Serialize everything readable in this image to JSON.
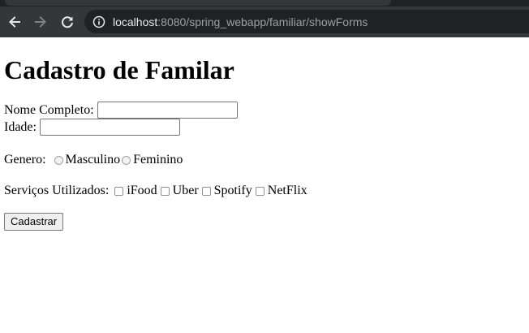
{
  "browser": {
    "url_host": "localhost",
    "url_rest": ":8080/spring_webapp/familiar/showForms",
    "icons": [
      "back-arrow-icon",
      "forward-arrow-icon",
      "reload-icon",
      "info-icon"
    ]
  },
  "page": {
    "title": "Cadastro de Familar",
    "name_label": "Nome Completo:",
    "name_value": "",
    "age_label": "Idade:",
    "age_value": "",
    "gender_label": "Genero:",
    "gender_options": [
      "Masculino",
      "Feminino"
    ],
    "services_label": "Serviços Utilizados:",
    "services_options": [
      "iFood",
      "Uber",
      "Spotify",
      "NetFlix"
    ],
    "submit_label": "Cadastrar"
  },
  "colors": {
    "chrome_dark": "#202124",
    "toolbar": "#35363a",
    "url_host": "#e8eaed",
    "url_path": "#9aa0a6"
  }
}
